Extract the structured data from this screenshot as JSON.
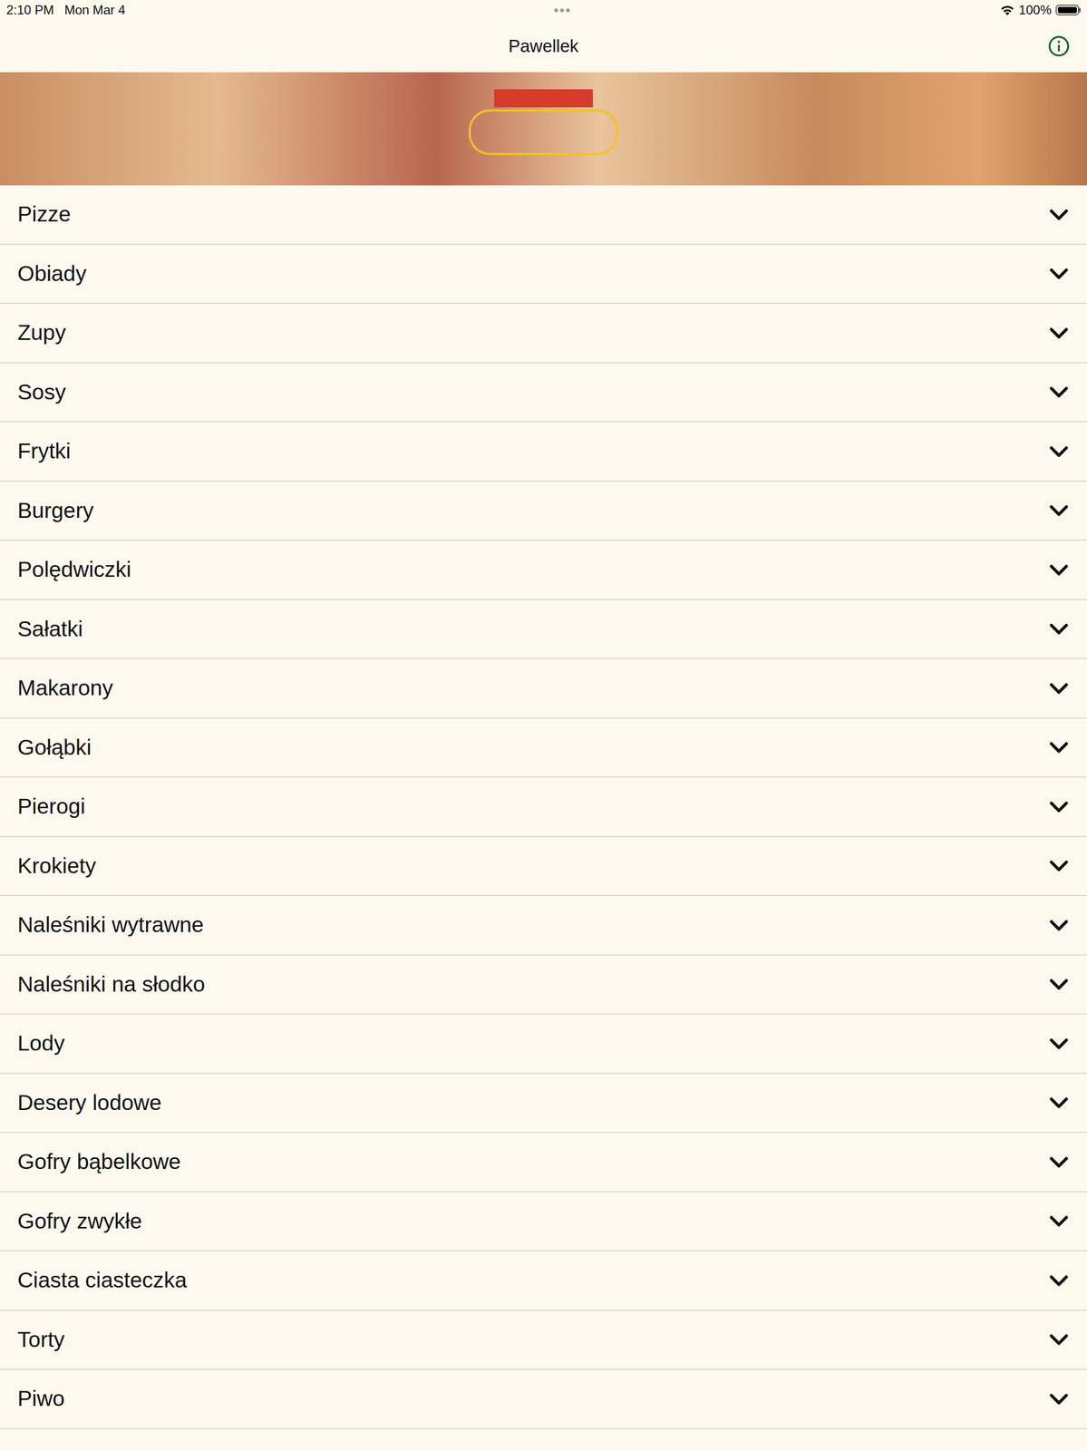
{
  "status_bar": {
    "time": "2:10 PM",
    "date": "Mon Mar 4",
    "dots": "•••",
    "battery": "100%",
    "battery_level": 1
  },
  "nav": {
    "title": "Pawellek"
  },
  "categories": [
    {
      "label": "Pizze",
      "expanded": false
    },
    {
      "label": "Obiady",
      "expanded": false
    },
    {
      "label": "Zupy",
      "expanded": false
    },
    {
      "label": "Sosy",
      "expanded": false
    },
    {
      "label": "Frytki",
      "expanded": false
    },
    {
      "label": "Burgery",
      "expanded": false
    },
    {
      "label": "Polędwiczki",
      "expanded": false
    },
    {
      "label": "Sałatki",
      "expanded": false
    },
    {
      "label": "Makarony",
      "expanded": false
    },
    {
      "label": "Gołąbki",
      "expanded": false
    },
    {
      "label": "Pierogi",
      "expanded": false
    },
    {
      "label": "Krokiety",
      "expanded": false
    },
    {
      "label": "Naleśniki wytrawne",
      "expanded": false
    },
    {
      "label": "Naleśniki na słodko",
      "expanded": false
    },
    {
      "label": "Lody",
      "expanded": false
    },
    {
      "label": "Desery lodowe",
      "expanded": false
    },
    {
      "label": "Gofry bąbelkowe",
      "expanded": false
    },
    {
      "label": "Gofry zwykłe",
      "expanded": false
    },
    {
      "label": "Ciasta ciasteczka",
      "expanded": false
    },
    {
      "label": "Torty",
      "expanded": false
    },
    {
      "label": "Piwo",
      "expanded": false
    }
  ]
}
